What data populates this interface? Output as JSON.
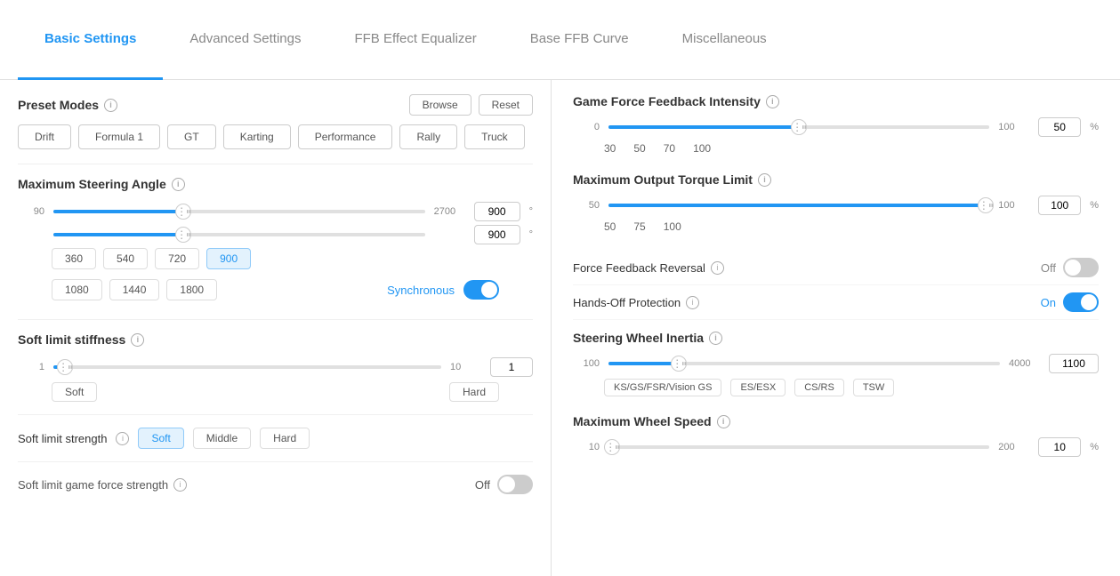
{
  "nav": {
    "tabs": [
      {
        "id": "basic",
        "label": "Basic Settings",
        "active": true
      },
      {
        "id": "advanced",
        "label": "Advanced Settings",
        "active": false
      },
      {
        "id": "ffb",
        "label": "FFB Effect Equalizer",
        "active": false
      },
      {
        "id": "base",
        "label": "Base FFB Curve",
        "active": false
      },
      {
        "id": "misc",
        "label": "Miscellaneous",
        "active": false
      }
    ]
  },
  "left": {
    "preset_modes": {
      "title": "Preset Modes",
      "browse_label": "Browse",
      "reset_label": "Reset",
      "presets": [
        "Drift",
        "Formula 1",
        "GT",
        "Karting",
        "Performance",
        "Rally",
        "Truck"
      ]
    },
    "steering_angle": {
      "title": "Maximum Steering Angle",
      "min": "90",
      "max": "2700",
      "value1": "900",
      "value2": "900",
      "fill_pct": 35,
      "thumb_pct": 35,
      "quick_values": [
        "360",
        "540",
        "720",
        "900",
        "1080",
        "1440",
        "1800"
      ],
      "synchronous_label": "Synchronous"
    },
    "soft_limit_stiffness": {
      "title": "Soft limit stiffness",
      "min": "1",
      "max": "10",
      "value": "1",
      "fill_pct": 3,
      "thumb_pct": 3,
      "soft_label": "Soft",
      "hard_label": "Hard"
    },
    "soft_limit_strength": {
      "title": "Soft limit strength",
      "options": [
        "Soft",
        "Middle",
        "Hard"
      ],
      "active": "Soft"
    },
    "soft_limit_game": {
      "title": "Soft limit game force strength",
      "value": "Off"
    }
  },
  "right": {
    "game_ffb": {
      "title": "Game Force Feedback Intensity",
      "min": "0",
      "max": "100",
      "value": "50",
      "unit": "%",
      "fill_pct": 50,
      "thumb_pct": 50,
      "quick_values": [
        "30",
        "50",
        "70",
        "100"
      ]
    },
    "max_torque": {
      "title": "Maximum Output Torque Limit",
      "min": "50",
      "max": "100",
      "value": "100",
      "unit": "%",
      "fill_pct": 100,
      "thumb_pct": 100,
      "quick_values": [
        "50",
        "75",
        "100"
      ]
    },
    "ffb_reversal": {
      "title": "Force Feedback Reversal",
      "value": "Off"
    },
    "hands_off": {
      "title": "Hands-Off Protection",
      "value": "On",
      "enabled": true
    },
    "steering_inertia": {
      "title": "Steering Wheel Inertia",
      "min": "100",
      "max": "4000",
      "value": "1100",
      "fill_pct": 18,
      "thumb_pct": 18,
      "presets": [
        "KS/GS/FSR/Vision GS",
        "ES/ESX",
        "CS/RS",
        "TSW"
      ]
    },
    "max_wheel_speed": {
      "title": "Maximum Wheel Speed",
      "min": "10",
      "max": "200",
      "value": "10",
      "unit": "%",
      "fill_pct": 1,
      "thumb_pct": 1
    }
  }
}
